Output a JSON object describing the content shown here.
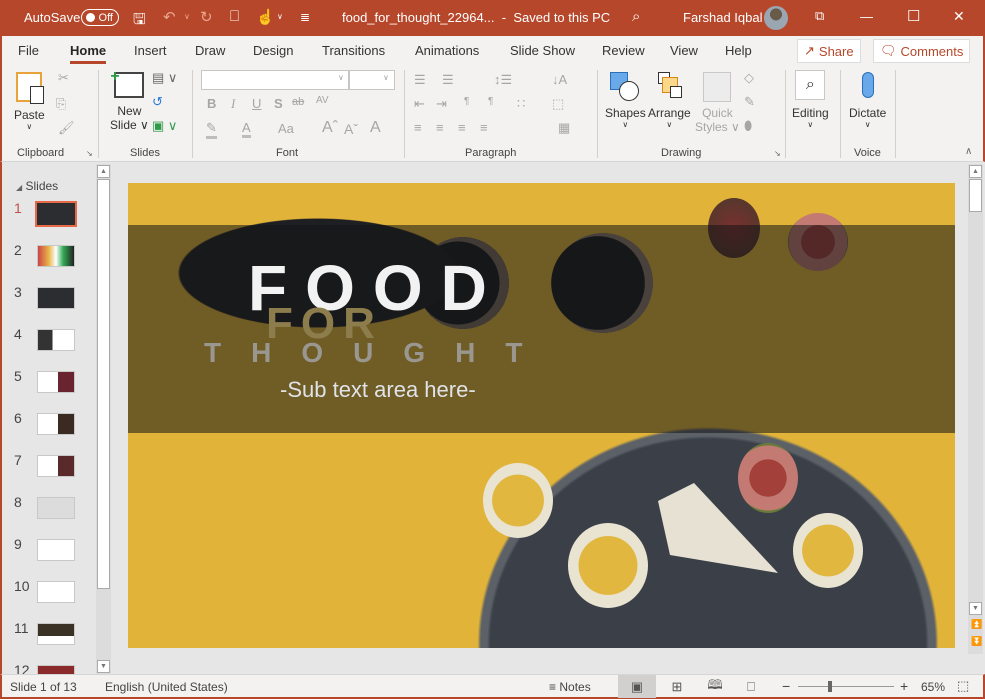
{
  "titlebar": {
    "autosave_label": "AutoSave",
    "autosave_state": "Off",
    "document_title": "food_for_thought_22964...",
    "separator": "-",
    "save_status": "Saved to this PC",
    "user_name": "Farshad Iqbal",
    "icons": {
      "save": "🖫",
      "undo": "↶",
      "redo": "↻",
      "present": "⎕",
      "touch": "☝",
      "customize": "≣",
      "search": "⌕",
      "ribbon_display": "⧉",
      "minimize": "—",
      "maximize": "☐",
      "close": "✕"
    }
  },
  "tabs": [
    {
      "label": "File"
    },
    {
      "label": "Home",
      "active": true
    },
    {
      "label": "Insert"
    },
    {
      "label": "Draw"
    },
    {
      "label": "Design"
    },
    {
      "label": "Transitions"
    },
    {
      "label": "Animations"
    },
    {
      "label": "Slide Show"
    },
    {
      "label": "Review"
    },
    {
      "label": "View"
    },
    {
      "label": "Help"
    }
  ],
  "share_label": "Share",
  "comments_label": "Comments",
  "ribbon": {
    "clipboard": {
      "label": "Clipboard",
      "paste": "Paste"
    },
    "slides": {
      "label": "Slides",
      "new_slide_line1": "New",
      "new_slide_line2": "Slide"
    },
    "font": {
      "label": "Font",
      "font_name": "",
      "font_size": "",
      "bold": "B",
      "italic": "I",
      "underline": "U",
      "shadow": "S",
      "strike": "ab",
      "spacing": "AV",
      "case": "Aa",
      "grow": "Aˆ",
      "shrink": "Aˇ",
      "clear": "A"
    },
    "paragraph": {
      "label": "Paragraph"
    },
    "drawing": {
      "label": "Drawing",
      "shapes": "Shapes",
      "arrange": "Arrange",
      "quick_styles_line1": "Quick",
      "quick_styles_line2": "Styles"
    },
    "editing": {
      "label": "Editing"
    },
    "voice": {
      "label": "Voice",
      "dictate": "Dictate"
    }
  },
  "slides_pane": {
    "header": "Slides",
    "slides": [
      {
        "number": "1",
        "selected": true
      },
      {
        "number": "2"
      },
      {
        "number": "3"
      },
      {
        "number": "4"
      },
      {
        "number": "5"
      },
      {
        "number": "6"
      },
      {
        "number": "7"
      },
      {
        "number": "8"
      },
      {
        "number": "9"
      },
      {
        "number": "10"
      },
      {
        "number": "11"
      },
      {
        "number": "12"
      }
    ]
  },
  "slide": {
    "title_line1": "FOOD",
    "title_line2": "FOR",
    "title_line3": "THOUGHT",
    "subtitle": "-Sub text area here-",
    "colors": {
      "title": "#f2f2f2",
      "accent": "#8d7d4c",
      "thought": "#9a9790"
    }
  },
  "statusbar": {
    "slide_counter": "Slide 1 of 13",
    "language": "English (United States)",
    "notes_label": "Notes",
    "zoom_level": "65%",
    "zoom_fraction": 0.31
  },
  "colors": {
    "brand": "#b7472a",
    "selected_thumb": "#e8684a"
  }
}
